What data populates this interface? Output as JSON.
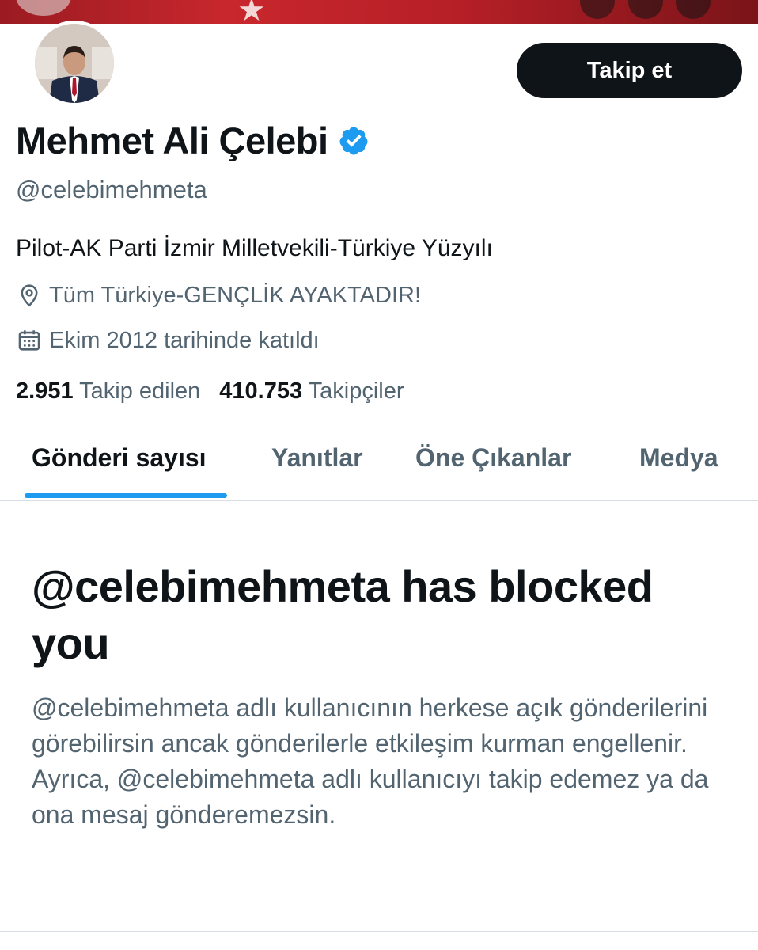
{
  "profile": {
    "name": "Mehmet Ali Çelebi",
    "handle": "@celebimehmeta",
    "bio": "Pilot-AK Parti İzmir Milletvekili-Türkiye Yüzyılı",
    "location": "Tüm Türkiye-GENÇLİK AYAKTADIR!",
    "joined": "Ekim 2012 tarihinde katıldı",
    "verified_color": "#1d9bf0"
  },
  "actions": {
    "follow_label": "Takip et"
  },
  "stats": {
    "following_count": "2.951",
    "following_label": "Takip edilen",
    "followers_count": "410.753",
    "followers_label": "Takipçiler"
  },
  "tabs": [
    {
      "label": "Gönderi sayısı",
      "active": true
    },
    {
      "label": "Yanıtlar",
      "active": false
    },
    {
      "label": "Öne Çıkanlar",
      "active": false
    },
    {
      "label": "Medya",
      "active": false
    }
  ],
  "blocked": {
    "title": "@celebimehmeta has blocked you",
    "description": "@celebimehmeta adlı kullanıcının herkese açık gönderilerini görebilirsin ancak gönderilerle etkileşim kurman engellenir. Ayrıca, @celebimehmeta adlı kullanıcıyı takip edemez ya da ona mesaj gönderemezsin."
  },
  "icons": {
    "verified": "verified-badge-icon",
    "location": "location-pin-icon",
    "calendar": "calendar-icon"
  }
}
